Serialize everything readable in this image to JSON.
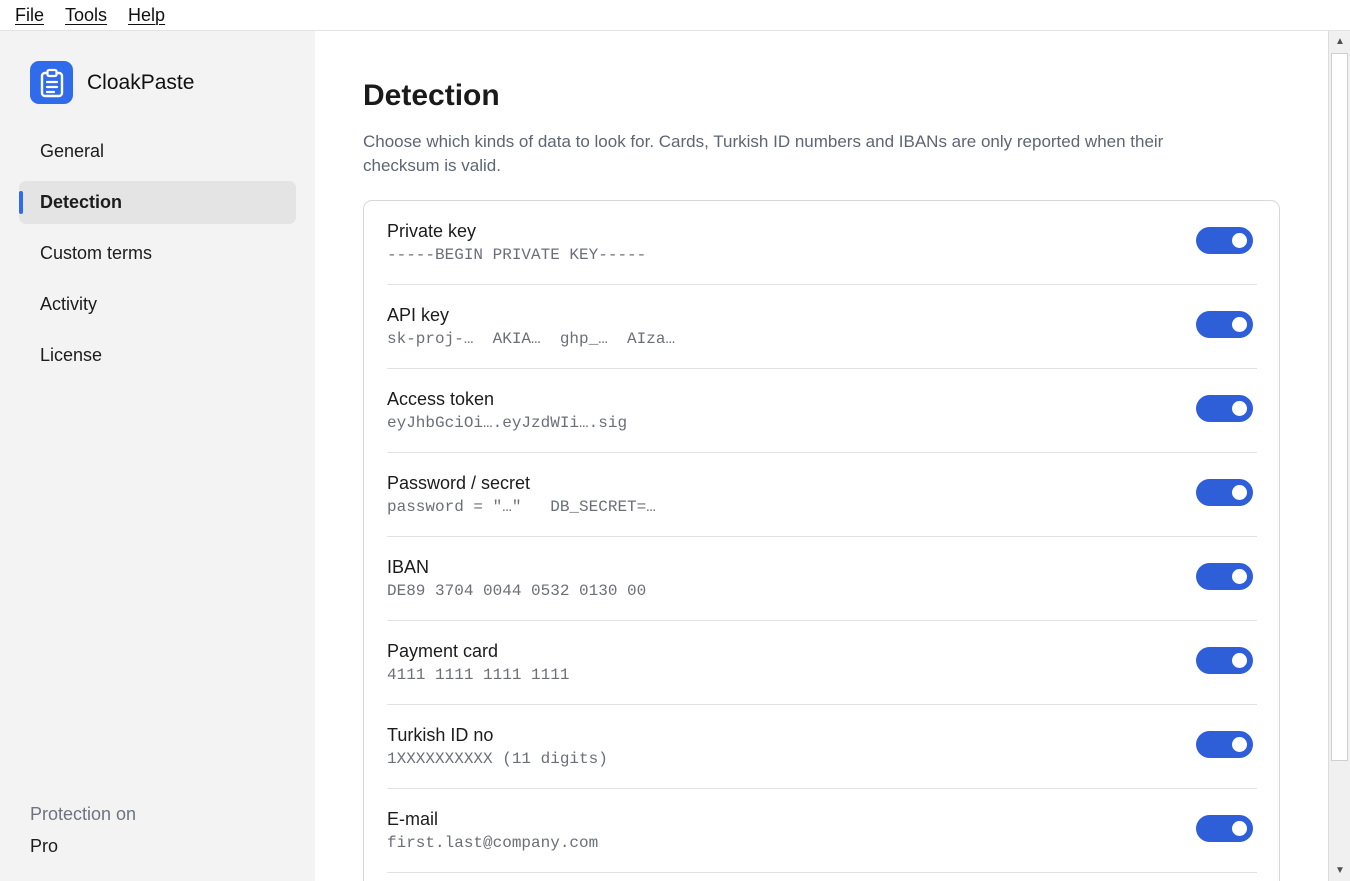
{
  "menubar": {
    "items": [
      "File",
      "Tools",
      "Help"
    ]
  },
  "app": {
    "name": "CloakPaste",
    "accent_color": "#2f6bea"
  },
  "sidebar": {
    "nav": [
      "General",
      "Detection",
      "Custom terms",
      "Activity",
      "License"
    ],
    "active_item": "Detection",
    "status": "Protection on",
    "plan": "Pro"
  },
  "main": {
    "title": "Detection",
    "description": "Choose which kinds of data to look for. Cards, Turkish ID numbers and IBANs are only reported when their checksum is valid.",
    "detectors": [
      {
        "name": "Private key",
        "example": "-----BEGIN PRIVATE KEY-----",
        "enabled": true
      },
      {
        "name": "API key",
        "example": "sk-proj-…  AKIA…  ghp_…  AIza…",
        "enabled": true
      },
      {
        "name": "Access token",
        "example": "eyJhbGciOi….eyJzdWIi….sig",
        "enabled": true
      },
      {
        "name": "Password / secret",
        "example": "password = \"…\"   DB_SECRET=…",
        "enabled": true
      },
      {
        "name": "IBAN",
        "example": "DE89 3704 0044 0532 0130 00",
        "enabled": true
      },
      {
        "name": "Payment card",
        "example": "4111 1111 1111 1111",
        "enabled": true
      },
      {
        "name": "Turkish ID no",
        "example": "1XXXXXXXXXX (11 digits)",
        "enabled": true
      },
      {
        "name": "E-mail",
        "example": "first.last@company.com",
        "enabled": true
      }
    ]
  }
}
